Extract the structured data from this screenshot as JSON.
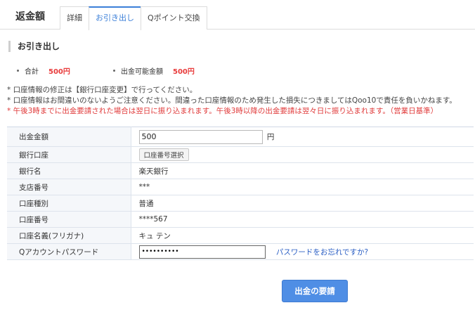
{
  "header": {
    "title": "返金額",
    "tabs": [
      {
        "label": "詳細",
        "active": false
      },
      {
        "label": "お引き出し",
        "active": true
      },
      {
        "label": "Qポイント交換",
        "active": false
      }
    ]
  },
  "section": {
    "title": "お引き出し"
  },
  "summary": {
    "total_label": "合計",
    "total_value": "500円",
    "available_label": "出金可能金額",
    "available_value": "500円"
  },
  "notes": [
    "* 口座情報の修正は【銀行口座変更】で行ってください。",
    "* 口座情報はお間違いのないようご注意ください。間違った口座情報のため発生した損失につきましてはQoo10で責任を負いかねます。",
    "* 午後3時までに出金要請された場合は翌日に振り込まれます。午後3時以降の出金要請は翌々日に振り込まれます。（営業日基準）"
  ],
  "form": {
    "amount_label": "出金金額",
    "amount_value": "500",
    "amount_unit": "円",
    "bank_account_label": "銀行口座",
    "bank_account_button": "口座番号選択",
    "bank_name_label": "銀行名",
    "bank_name_value": "楽天銀行",
    "branch_label": "支店番号",
    "branch_value": "***",
    "account_type_label": "口座種別",
    "account_type_value": "普通",
    "account_number_label": "口座番号",
    "account_number_value": "****567",
    "account_holder_label": "口座名義(フリガナ)",
    "account_holder_value": "キュ テン",
    "password_label": "Qアカウントパスワード",
    "password_value": "••••••••••",
    "forgot_link": "パスワードをお忘れですか?"
  },
  "submit_label": "出金の要請",
  "colors": {
    "accent": "#3b7fd8",
    "price": "#e83b3b",
    "warning": "#e03a3a",
    "button": "#4f8ee5"
  }
}
